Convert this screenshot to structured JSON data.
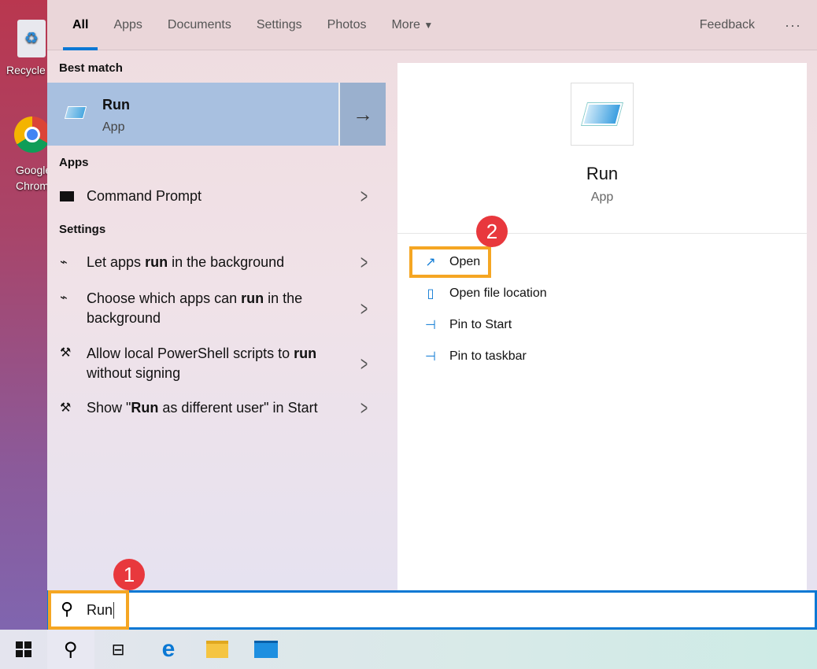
{
  "desktop": {
    "icons": [
      {
        "label": "Recycle Bin"
      },
      {
        "label": "Google Chrome"
      }
    ]
  },
  "tabs": [
    {
      "label": "All",
      "active": true
    },
    {
      "label": "Apps"
    },
    {
      "label": "Documents"
    },
    {
      "label": "Settings"
    },
    {
      "label": "Photos"
    },
    {
      "label": "More"
    }
  ],
  "feedback": "Feedback",
  "more_options": "···",
  "best_match": {
    "header": "Best match",
    "title": "Run",
    "subtitle": "App"
  },
  "apps": {
    "header": "Apps",
    "items": [
      {
        "label": "Command Prompt"
      }
    ]
  },
  "settings": {
    "header": "Settings",
    "items": [
      {
        "pre": "Let apps ",
        "bold": "run",
        "post": " in the background"
      },
      {
        "pre": "Choose which apps can ",
        "bold": "run",
        "post": " in the background"
      },
      {
        "pre": "Allow local PowerShell scripts to ",
        "bold": "run",
        "post": " without signing"
      },
      {
        "pre": "Show \"",
        "bold": "Run",
        "post": " as different user\" in Start"
      }
    ]
  },
  "preview": {
    "title": "Run",
    "subtitle": "App",
    "actions": [
      {
        "label": "Open"
      },
      {
        "label": "Open file location"
      },
      {
        "label": "Pin to Start"
      },
      {
        "label": "Pin to taskbar"
      }
    ]
  },
  "search": {
    "value": "Run"
  },
  "badges": [
    "1",
    "2"
  ],
  "colors": {
    "accent": "#0a78d4",
    "highlight": "#f5a623",
    "badge": "#e8383d"
  }
}
